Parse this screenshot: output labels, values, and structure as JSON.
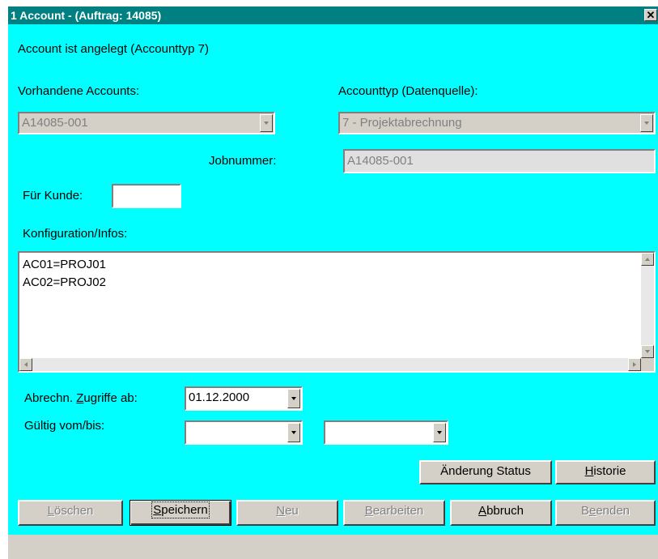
{
  "window": {
    "title": "1 Account - (Auftrag: 14085)",
    "close_glyph": "✕"
  },
  "status_message": "Account ist angelegt (Accounttyp 7)",
  "existing_accounts": {
    "label": "Vorhandene Accounts:",
    "value": "A14085-001"
  },
  "account_type": {
    "label": "Accounttyp (Datenquelle):",
    "value": "7 - Projektabrechnung"
  },
  "job_number": {
    "label": "Jobnummer:",
    "value": "A14085-001"
  },
  "customer": {
    "label": "Für Kunde:",
    "value": ""
  },
  "config": {
    "label": "Konfiguration/Infos:",
    "lines": [
      "AC01=PROJ01",
      "AC02=PROJ02"
    ]
  },
  "billing_access": {
    "label_prefix": "Abrechn. ",
    "label_underlined": "Z",
    "label_suffix": "ugriffe ab:",
    "value": "01.12.2000"
  },
  "validity": {
    "label": "Gültig vom/bis:",
    "from": "",
    "to": ""
  },
  "buttons": {
    "change_status": "Änderung Status",
    "history_u": "H",
    "history_rest": "istorie",
    "delete_u": "L",
    "delete_rest": "öschen",
    "save_u": "S",
    "save_rest": "peichern",
    "new_u": "N",
    "new_rest": "eu",
    "edit_u": "B",
    "edit_rest": "earbeiten",
    "cancel_u": "A",
    "cancel_rest": "bbruch",
    "exit_pre": "B",
    "exit_u": "e",
    "exit_rest": "enden"
  },
  "colors": {
    "titlebar": "#008080",
    "dialog_background": "#00ffff",
    "button_face": "#d4d0c8"
  }
}
